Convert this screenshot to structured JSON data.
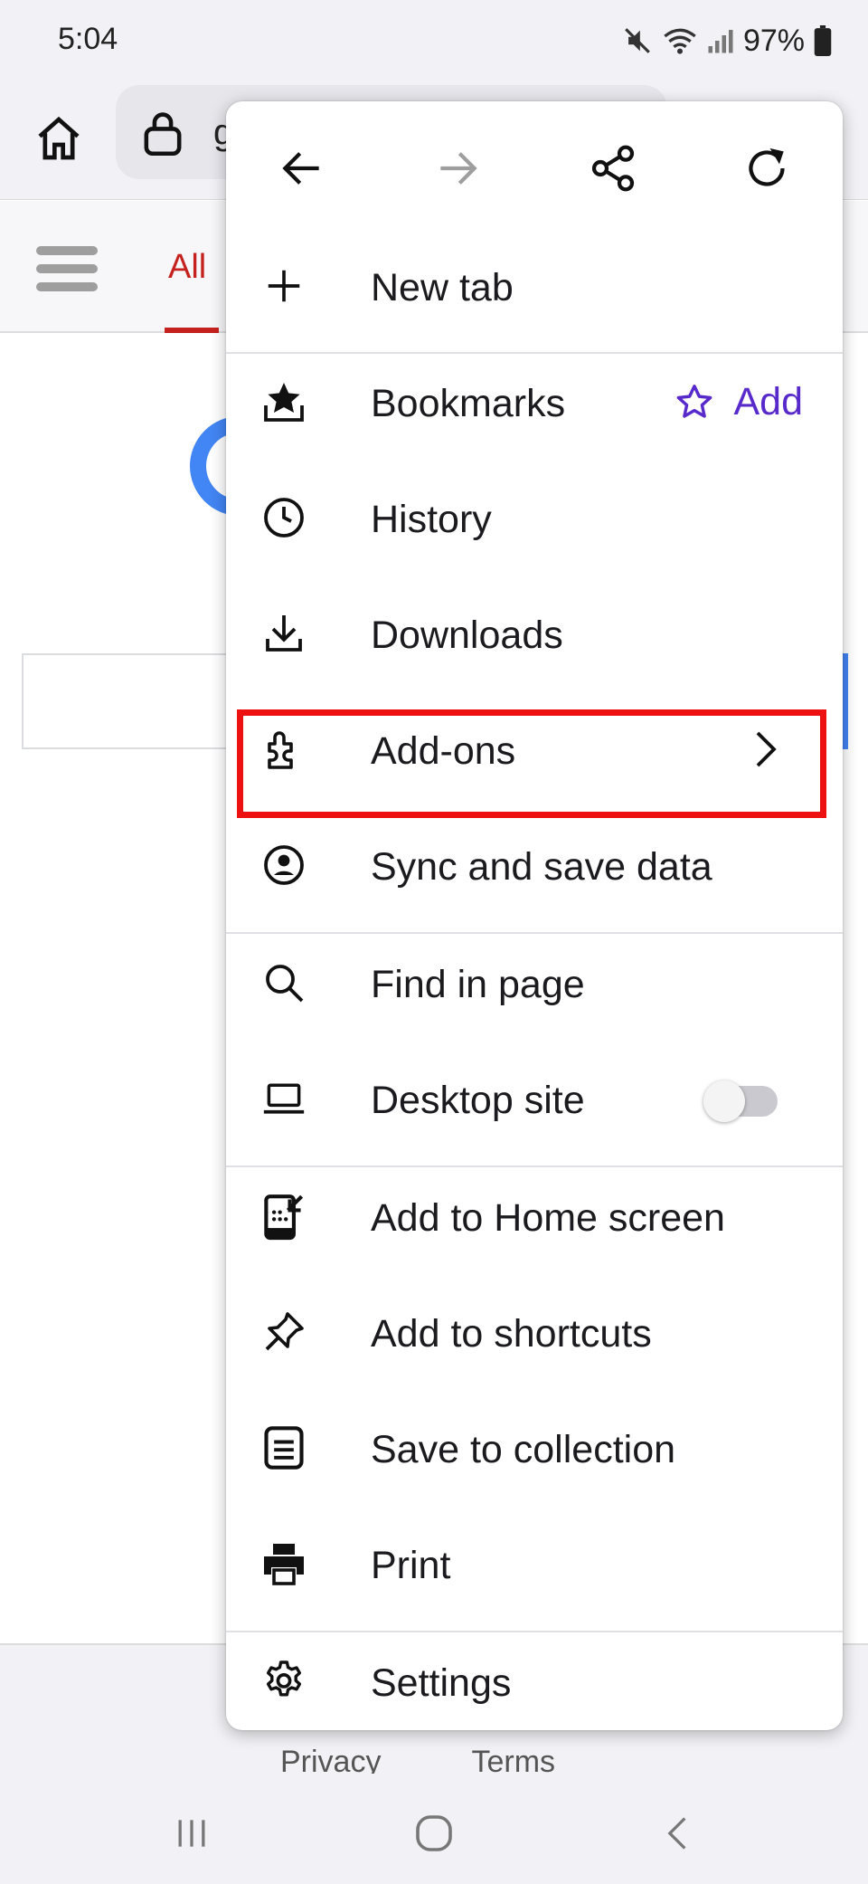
{
  "status_bar": {
    "time": "5:04",
    "battery": "97%"
  },
  "toolbar": {
    "url_fragment": "g"
  },
  "search_page": {
    "tab_all": "All",
    "footer_links": [
      "Privacy",
      "Terms"
    ]
  },
  "menu": {
    "new_tab": "New tab",
    "bookmarks": "Bookmarks",
    "bookmarks_add": "Add",
    "history": "History",
    "downloads": "Downloads",
    "addons": "Add-ons",
    "sync": "Sync and save data",
    "find_in_page": "Find in page",
    "desktop_site": "Desktop site",
    "desktop_site_enabled": false,
    "add_home": "Add to Home screen",
    "add_shortcuts": "Add to shortcuts",
    "save_collection": "Save to collection",
    "print": "Print",
    "settings": "Settings"
  },
  "colors": {
    "accent": "#592acb",
    "highlight": "#ee1111",
    "tab_active": "#c5221f"
  }
}
